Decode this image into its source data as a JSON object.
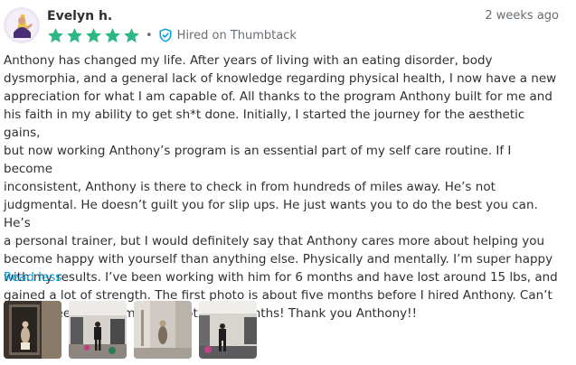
{
  "review": {
    "reviewer_name": "Evelyn h.",
    "date": "2 weeks ago",
    "rating": 5,
    "rating_max": 5,
    "star_color": "#2db783",
    "separator": "•",
    "hired_label": "Hired on Thumbtack",
    "hired_icon": "shield-check-icon",
    "text": "Anthony has changed my life. After years of living with an eating disorder, body\ndysmorphia, and a general lack of knowledge regarding physical health, I now have a new\nappreciation for what I am capable of. All thanks to the program Anthony built for me and\nhis faith in my ability to get sh*t done. Initially, I started the journey for the aesthetic gains,\nbut now working Anthony’s program is an essential part of my self care routine. If I become\ninconsistent, Anthony is there to check in from hundreds of miles away. He’s not\njudgmental. He doesn’t guilt you for slip ups. He just wants you to do the best you can. He’s\na personal trainer, but I would definitely say that Anthony cares more about helping you\nbecome happy with yourself than anything else. Physically and mentally. I’m super happy\nwith my results. I’ve been working with him for 6 months and have lost around 15 lbs, and\ngained a lot of strength. The first photo is about five months before I hired Anthony. Can’t\nwait to see where I’m at in another 6 months! Thank you Anthony!!",
    "read_less_label": "Read less",
    "link_color": "#009fd9",
    "photo_count": 4
  }
}
